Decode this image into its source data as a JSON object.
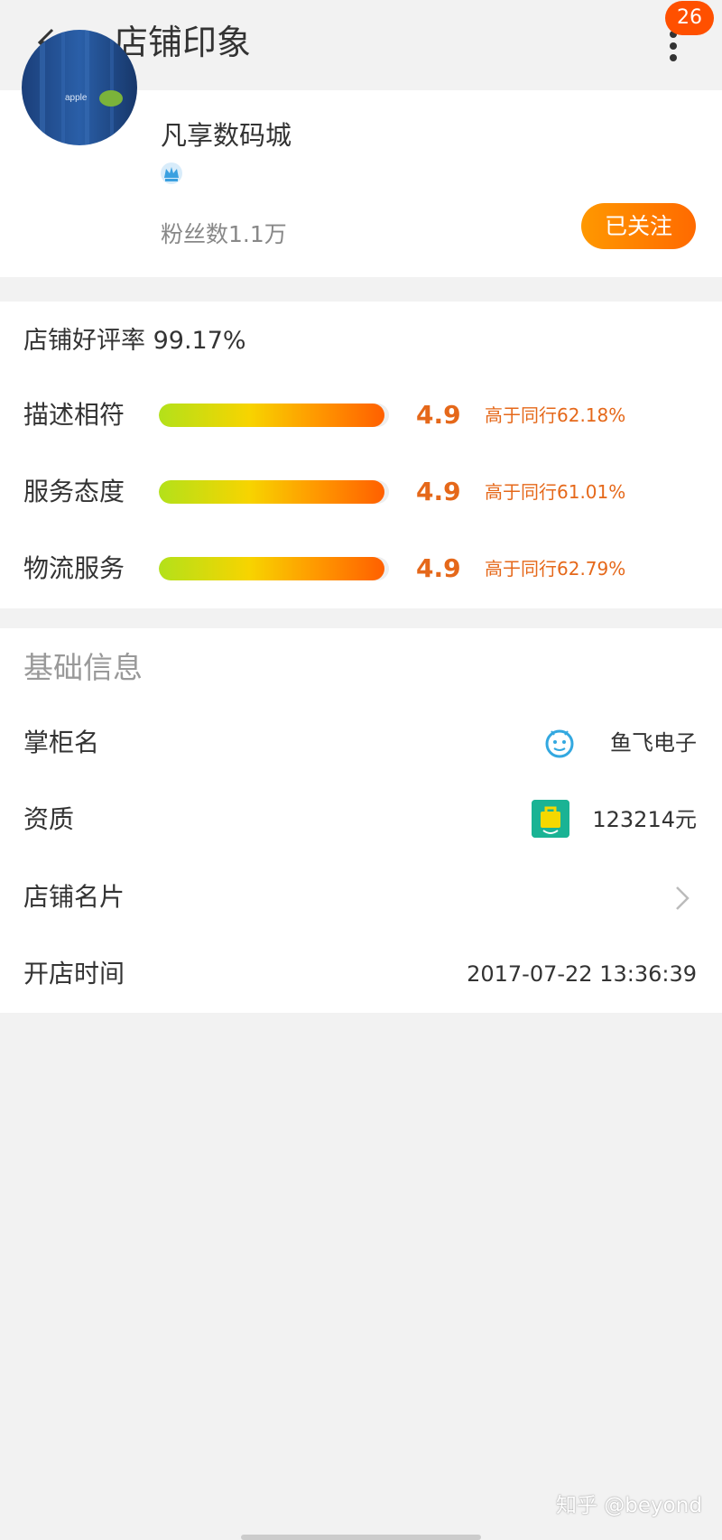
{
  "header": {
    "title": "店铺印象",
    "badge_count": "26"
  },
  "shop": {
    "name": "凡享数码城",
    "fans": "粉丝数1.1万",
    "follow_label": "已关注",
    "avatar_text": "apple"
  },
  "rating": {
    "title": "店铺好评率 99.17%",
    "rows": [
      {
        "label": "描述相符",
        "score": "4.9",
        "compare": "高于同行62.18%",
        "level": 0.98
      },
      {
        "label": "服务态度",
        "score": "4.9",
        "compare": "高于同行61.01%",
        "level": 0.98
      },
      {
        "label": "物流服务",
        "score": "4.9",
        "compare": "高于同行62.79%",
        "level": 0.98
      }
    ]
  },
  "info": {
    "title": "基础信息",
    "rows": [
      {
        "label": "掌柜名",
        "value": "鱼飞电子"
      },
      {
        "label": "资质",
        "value": "123214元"
      },
      {
        "label": "店铺名片",
        "value": ""
      },
      {
        "label": "开店时间",
        "value": "2017-07-22 13:36:39"
      }
    ]
  },
  "watermark": "知乎 @beyond",
  "colors": {
    "accent": "#ff5000",
    "score": "#e5681a",
    "follow_start": "#ff9800",
    "follow_end": "#ff6a00",
    "qualification_icon": "#1ab394"
  },
  "icons": [
    "back-arrow-icon",
    "more-menu-icon",
    "crown-icon",
    "mascot-icon",
    "bag-icon",
    "chevron-right-icon"
  ]
}
